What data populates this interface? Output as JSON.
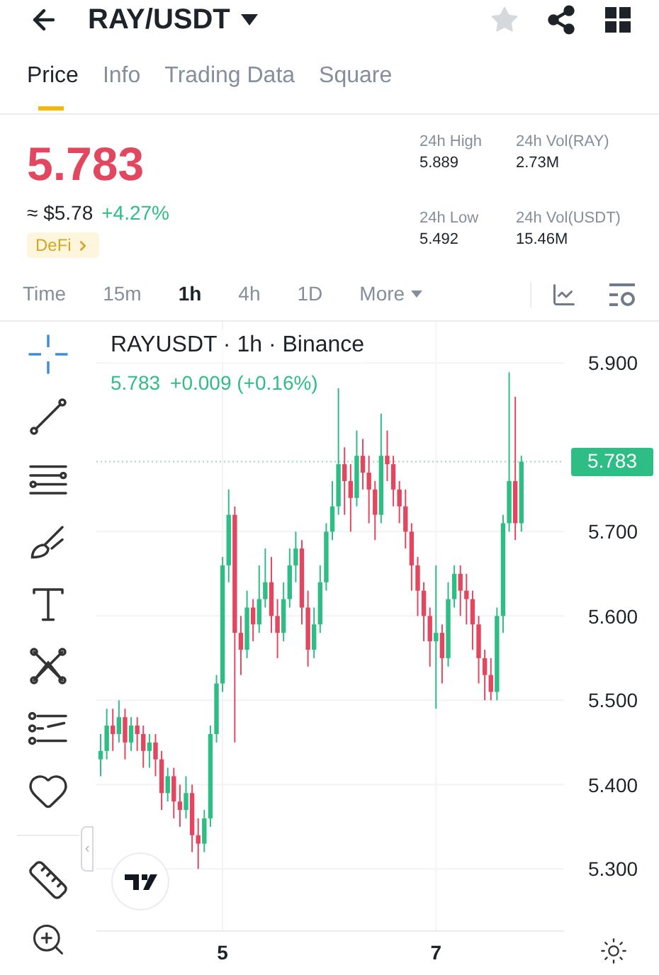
{
  "header": {
    "title": "RAY/USDT",
    "favorite": false
  },
  "tabs": [
    {
      "label": "Price",
      "selected": true
    },
    {
      "label": "Info",
      "selected": false
    },
    {
      "label": "Trading Data",
      "selected": false
    },
    {
      "label": "Square",
      "selected": false
    }
  ],
  "price": {
    "last": "5.783",
    "fiat": "≈ $5.78",
    "change": "+4.27%",
    "tag": "DeFi"
  },
  "stats": [
    {
      "label": "24h High",
      "value": "5.889"
    },
    {
      "label": "24h Vol(RAY)",
      "value": "2.73M"
    },
    {
      "label": "24h Low",
      "value": "5.492"
    },
    {
      "label": "24h Vol(USDT)",
      "value": "15.46M"
    }
  ],
  "intervals": [
    {
      "label": "Time",
      "kind": "option",
      "selected": false
    },
    {
      "label": "15m",
      "kind": "option",
      "selected": false
    },
    {
      "label": "1h",
      "kind": "option",
      "selected": true
    },
    {
      "label": "4h",
      "kind": "option",
      "selected": false
    },
    {
      "label": "1D",
      "kind": "option",
      "selected": false
    },
    {
      "label": "More",
      "kind": "dropdown",
      "selected": false
    }
  ],
  "chart": {
    "title": "RAYUSDT · 1h · Binance",
    "last": "5.783",
    "change": "+0.009 (+0.16%)",
    "price_label": "5.783",
    "chart_data": {
      "type": "candlestick",
      "categories": [
        null,
        null,
        null,
        null,
        null,
        null,
        null,
        null,
        null,
        null,
        null,
        null,
        null,
        null,
        null,
        null,
        null,
        null,
        null,
        null,
        "5",
        null,
        null,
        null,
        null,
        null,
        null,
        null,
        null,
        null,
        null,
        null,
        null,
        null,
        null,
        null,
        null,
        null,
        null,
        null,
        null,
        null,
        null,
        null,
        null,
        null,
        null,
        null,
        null,
        null,
        null,
        null,
        null,
        null,
        null,
        "7",
        null,
        null,
        null,
        null,
        null,
        null,
        null,
        null,
        null,
        null,
        null,
        null,
        null,
        null
      ],
      "ohlc": [
        [
          5.43,
          5.46,
          5.41,
          5.44
        ],
        [
          5.44,
          5.49,
          5.43,
          5.47
        ],
        [
          5.47,
          5.49,
          5.44,
          5.46
        ],
        [
          5.46,
          5.5,
          5.45,
          5.48
        ],
        [
          5.48,
          5.49,
          5.43,
          5.45
        ],
        [
          5.45,
          5.48,
          5.44,
          5.47
        ],
        [
          5.47,
          5.48,
          5.44,
          5.46
        ],
        [
          5.46,
          5.47,
          5.42,
          5.44
        ],
        [
          5.44,
          5.46,
          5.42,
          5.45
        ],
        [
          5.45,
          5.46,
          5.41,
          5.43
        ],
        [
          5.43,
          5.44,
          5.37,
          5.39
        ],
        [
          5.39,
          5.42,
          5.38,
          5.41
        ],
        [
          5.41,
          5.42,
          5.36,
          5.38
        ],
        [
          5.38,
          5.4,
          5.35,
          5.37
        ],
        [
          5.37,
          5.41,
          5.36,
          5.39
        ],
        [
          5.39,
          5.4,
          5.32,
          5.34
        ],
        [
          5.34,
          5.36,
          5.3,
          5.33
        ],
        [
          5.33,
          5.37,
          5.32,
          5.36
        ],
        [
          5.36,
          5.47,
          5.35,
          5.46
        ],
        [
          5.46,
          5.53,
          5.45,
          5.52
        ],
        [
          5.52,
          5.67,
          5.51,
          5.66
        ],
        [
          5.66,
          5.75,
          5.64,
          5.72
        ],
        [
          5.72,
          5.73,
          5.45,
          5.58
        ],
        [
          5.58,
          5.6,
          5.53,
          5.56
        ],
        [
          5.56,
          5.63,
          5.55,
          5.61
        ],
        [
          5.61,
          5.62,
          5.57,
          5.59
        ],
        [
          5.59,
          5.66,
          5.58,
          5.62
        ],
        [
          5.62,
          5.68,
          5.61,
          5.64
        ],
        [
          5.64,
          5.67,
          5.58,
          5.6
        ],
        [
          5.6,
          5.62,
          5.55,
          5.58
        ],
        [
          5.58,
          5.64,
          5.57,
          5.62
        ],
        [
          5.62,
          5.68,
          5.61,
          5.66
        ],
        [
          5.66,
          5.7,
          5.64,
          5.68
        ],
        [
          5.68,
          5.69,
          5.59,
          5.61
        ],
        [
          5.61,
          5.63,
          5.54,
          5.56
        ],
        [
          5.56,
          5.61,
          5.55,
          5.59
        ],
        [
          5.59,
          5.66,
          5.58,
          5.64
        ],
        [
          5.64,
          5.71,
          5.63,
          5.7
        ],
        [
          5.7,
          5.76,
          5.69,
          5.73
        ],
        [
          5.73,
          5.87,
          5.72,
          5.78
        ],
        [
          5.78,
          5.8,
          5.72,
          5.76
        ],
        [
          5.76,
          5.78,
          5.7,
          5.74
        ],
        [
          5.74,
          5.82,
          5.73,
          5.79
        ],
        [
          5.79,
          5.81,
          5.75,
          5.77
        ],
        [
          5.77,
          5.79,
          5.71,
          5.75
        ],
        [
          5.75,
          5.76,
          5.69,
          5.72
        ],
        [
          5.72,
          5.84,
          5.71,
          5.79
        ],
        [
          5.79,
          5.82,
          5.76,
          5.78
        ],
        [
          5.78,
          5.79,
          5.73,
          5.75
        ],
        [
          5.75,
          5.76,
          5.71,
          5.73
        ],
        [
          5.73,
          5.75,
          5.68,
          5.7
        ],
        [
          5.7,
          5.71,
          5.63,
          5.66
        ],
        [
          5.66,
          5.67,
          5.6,
          5.63
        ],
        [
          5.63,
          5.64,
          5.57,
          5.6
        ],
        [
          5.6,
          5.61,
          5.54,
          5.57
        ],
        [
          5.57,
          5.66,
          5.49,
          5.58
        ],
        [
          5.58,
          5.59,
          5.52,
          5.55
        ],
        [
          5.55,
          5.64,
          5.54,
          5.62
        ],
        [
          5.62,
          5.66,
          5.61,
          5.65
        ],
        [
          5.65,
          5.66,
          5.6,
          5.63
        ],
        [
          5.63,
          5.65,
          5.59,
          5.62
        ],
        [
          5.62,
          5.63,
          5.56,
          5.59
        ],
        [
          5.59,
          5.6,
          5.52,
          5.55
        ],
        [
          5.55,
          5.56,
          5.5,
          5.53
        ],
        [
          5.53,
          5.55,
          5.5,
          5.51
        ],
        [
          5.51,
          5.61,
          5.5,
          5.6
        ],
        [
          5.6,
          5.72,
          5.58,
          5.71
        ],
        [
          5.71,
          5.889,
          5.7,
          5.76
        ],
        [
          5.76,
          5.86,
          5.69,
          5.71
        ],
        [
          5.71,
          5.79,
          5.7,
          5.783
        ]
      ],
      "ylim": [
        5.223,
        5.949
      ],
      "grid": true,
      "ref_lines": [
        {
          "axis": "y",
          "value": 5.783,
          "color": "#9bd7bf"
        }
      ],
      "yticks": [
        {
          "value": 5.9,
          "label": "5.900"
        },
        {
          "value": 5.7,
          "label": "5.700"
        },
        {
          "value": 5.6,
          "label": "5.600"
        },
        {
          "value": 5.5,
          "label": "5.500"
        },
        {
          "value": 5.4,
          "label": "5.400"
        },
        {
          "value": 5.3,
          "label": "5.300"
        }
      ]
    }
  }
}
